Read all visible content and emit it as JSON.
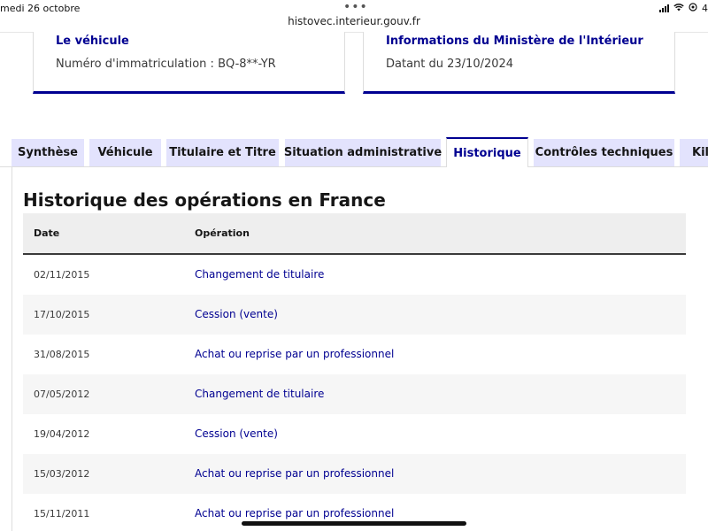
{
  "status_bar": {
    "date": "medi 26 octobre",
    "dots": "•••",
    "battery": "4"
  },
  "browser": {
    "url": "histovec.interieur.gouv.fr"
  },
  "cards": {
    "vehicle": {
      "title": "Le véhicule",
      "text": "Numéro d'immatriculation : BQ-8**-YR"
    },
    "ministry": {
      "title": "Informations du Ministère de l'Intérieur",
      "text": "Datant du 23/10/2024"
    }
  },
  "tabs": [
    {
      "label": "Synthèse",
      "active": false
    },
    {
      "label": "Véhicule",
      "active": false
    },
    {
      "label": "Titulaire et Titre",
      "active": false
    },
    {
      "label": "Situation administrative",
      "active": false
    },
    {
      "label": "Historique",
      "active": true
    },
    {
      "label": "Contrôles techniques",
      "active": false
    },
    {
      "label": "Kilo",
      "active": false
    }
  ],
  "section": {
    "title": "Historique des opérations en France"
  },
  "table": {
    "headers": {
      "date": "Date",
      "operation": "Opération"
    },
    "rows": [
      {
        "date": "02/11/2015",
        "operation": "Changement de titulaire"
      },
      {
        "date": "17/10/2015",
        "operation": "Cession (vente)"
      },
      {
        "date": "31/08/2015",
        "operation": "Achat ou reprise par un professionnel"
      },
      {
        "date": "07/05/2012",
        "operation": "Changement de titulaire"
      },
      {
        "date": "19/04/2012",
        "operation": "Cession (vente)"
      },
      {
        "date": "15/03/2012",
        "operation": "Achat ou reprise par un professionnel"
      },
      {
        "date": "15/11/2011",
        "operation": "Achat ou reprise par un professionnel"
      }
    ]
  },
  "colors": {
    "accent": "#000091",
    "tab_bg": "#e3e3fd",
    "row_alt": "#f6f6f6"
  },
  "icons": [
    "signal-icon",
    "wifi-icon",
    "location-icon",
    "battery-icon"
  ]
}
